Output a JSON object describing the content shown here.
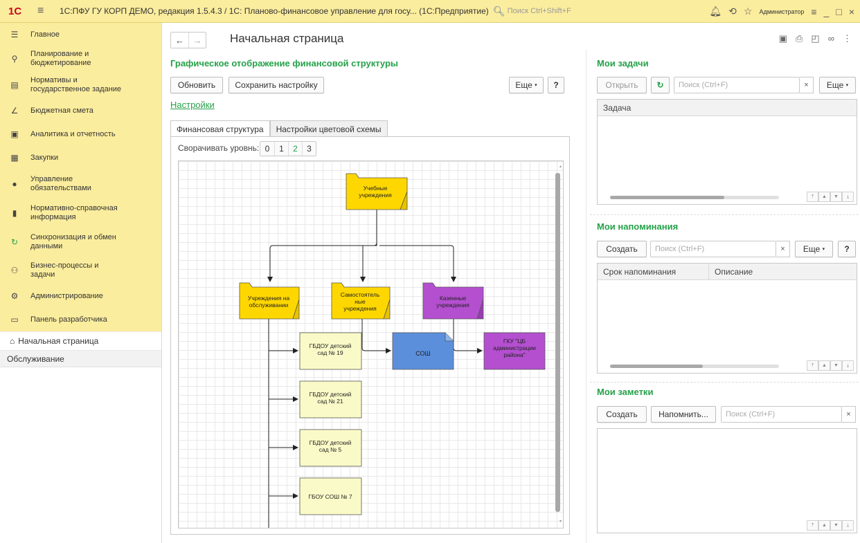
{
  "titlebar": {
    "logo": "1С",
    "title": "1С:ПФУ ГУ КОРП ДЕМО, редакция 1.5.4.3 / 1С: Планово-финансовое управление для госу...  (1С:Предприятие)",
    "search_placeholder": "Поиск Ctrl+Shift+F",
    "user": "Администратор"
  },
  "sidebar": {
    "items": [
      {
        "label": "Главное",
        "icon": "menu-lines-icon"
      },
      {
        "label": "Планирование и\nбюджетирование",
        "icon": "planning-icon"
      },
      {
        "label": "Нормативы и\nгосударственное задание",
        "icon": "standards-icon"
      },
      {
        "label": "Бюджетная смета",
        "icon": "budget-icon"
      },
      {
        "label": "Аналитика и отчетность",
        "icon": "analytics-icon"
      },
      {
        "label": "Закупки",
        "icon": "purchases-icon"
      },
      {
        "label": "Управление\nобязательствами",
        "icon": "obligations-icon"
      },
      {
        "label": "Нормативно-справочная\nинформация",
        "icon": "reference-icon"
      },
      {
        "label": "Синхронизация и обмен\nданными",
        "icon": "sync-icon"
      },
      {
        "label": "Бизнес-процессы и\nзадачи",
        "icon": "users-icon"
      },
      {
        "label": "Администрирование",
        "icon": "gear-icon"
      },
      {
        "label": "Панель разработчика",
        "icon": "monitor-icon"
      }
    ],
    "active": "Начальная страница",
    "service": "Обслуживание"
  },
  "page": {
    "title": "Начальная страница"
  },
  "structure": {
    "title": "Графическое отображение финансовой структуры",
    "refresh": "Обновить",
    "save_settings": "Сохранить настройку",
    "more": "Еще",
    "help": "?",
    "settings_link": "Настройки",
    "tabs": [
      "Финансовая структура",
      "Настройки цветовой схемы"
    ],
    "collapse_label": "Сворачивать уровнь:",
    "levels": [
      "0",
      "1",
      "2",
      "3"
    ],
    "selected_level": "2",
    "nodes": {
      "root": "Учебные\nучреждения",
      "n1": "Учреждения на\nобслуживании",
      "n2": "Самостоятель\nные\nучреждения",
      "n3": "Казенные\nучреждения",
      "l1": "ГБДОУ детский\nсад № 19",
      "l2": "ГБДОУ детский\nсад № 21",
      "l3": "ГБДОУ детский\nсад № 5",
      "l4": "ГБОУ СОШ № 7",
      "sosh": "СОШ",
      "gku": "ГКУ \"ЦБ\nадминистрации\nрайона\""
    }
  },
  "tasks": {
    "title": "Мои задачи",
    "open": "Открыть",
    "search_placeholder": "Поиск (Ctrl+F)",
    "more": "Еще",
    "col": "Задача"
  },
  "reminders": {
    "title": "Мои напоминания",
    "create": "Создать",
    "search_placeholder": "Поиск (Ctrl+F)",
    "more": "Еще",
    "help": "?",
    "col1": "Срок напоминания",
    "col2": "Описание"
  },
  "notes": {
    "title": "Мои заметки",
    "create": "Создать",
    "remind": "Напомнить...",
    "search_placeholder": "Поиск (Ctrl+F)"
  },
  "colors": {
    "accent": "#24a148",
    "yellow": "#ffd700",
    "purple": "#b44fd0",
    "blue": "#5b8fdc",
    "leaf": "#fafac8"
  }
}
